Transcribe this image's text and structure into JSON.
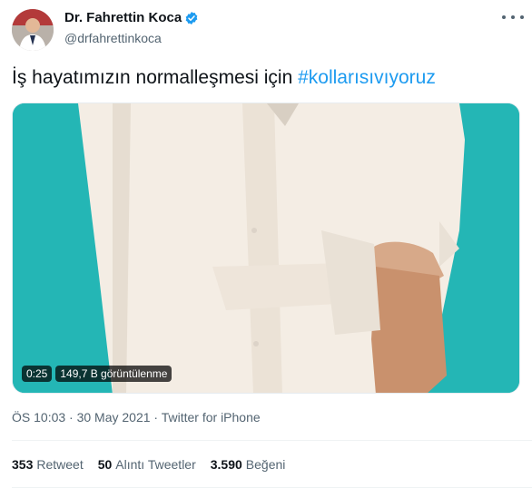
{
  "author": {
    "name": "Dr. Fahrettin Koca",
    "handle": "@drfahrettinkoca",
    "verified": true
  },
  "tweet": {
    "text": "İş hayatımızın normalleşmesi için ",
    "hashtag": "#kollarısıvıyoruz"
  },
  "video": {
    "duration": "0:25",
    "views": "149,7 B görüntülenme"
  },
  "meta": "ÖS 10:03 · 30 May 2021 · Twitter for iPhone",
  "stats": {
    "retweets_count": "353",
    "retweets_label": "Retweet",
    "quotes_count": "50",
    "quotes_label": "Alıntı Tweetler",
    "likes_count": "3.590",
    "likes_label": "Beğeni"
  },
  "colors": {
    "accent": "#1d9bf0",
    "video_background": "#24b6b5"
  }
}
